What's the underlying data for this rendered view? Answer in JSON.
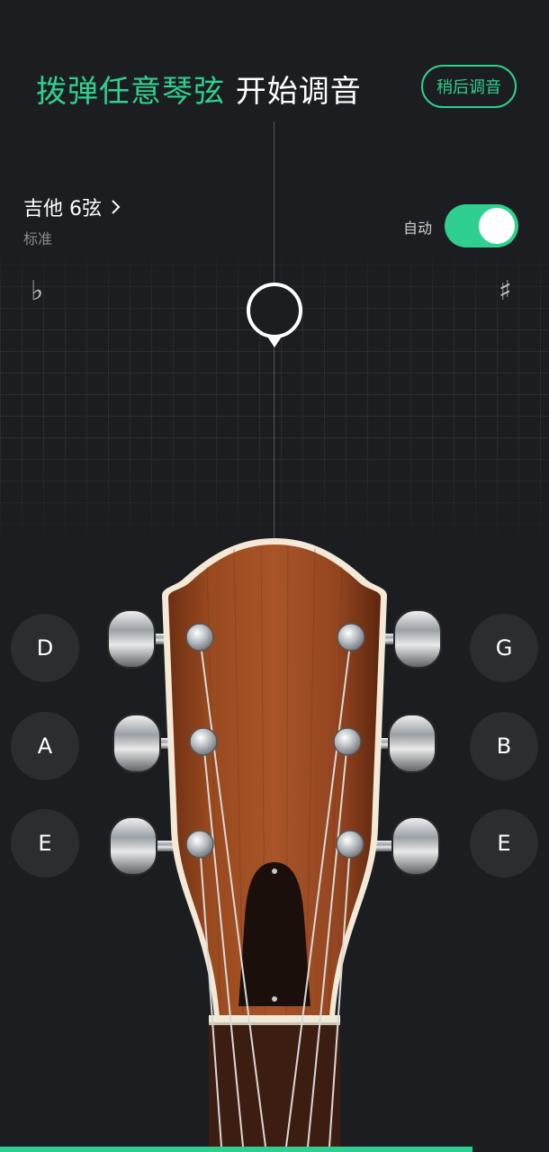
{
  "header": {
    "title_highlight": "拨弹任意琴弦",
    "title_rest": " 开始调音",
    "later_button": "稍后调音"
  },
  "instrument": {
    "name": "吉他 6弦",
    "tuning": "标准"
  },
  "auto_toggle": {
    "label": "自动",
    "on": true
  },
  "symbols": {
    "flat": "♭",
    "sharp": "♯"
  },
  "strings": {
    "left": [
      "D",
      "A",
      "E"
    ],
    "right": [
      "G",
      "B",
      "E"
    ]
  },
  "progress": 0.86,
  "colors": {
    "accent": "#2fd08f",
    "background": "#1c1d20",
    "button": "#2c2d31"
  }
}
